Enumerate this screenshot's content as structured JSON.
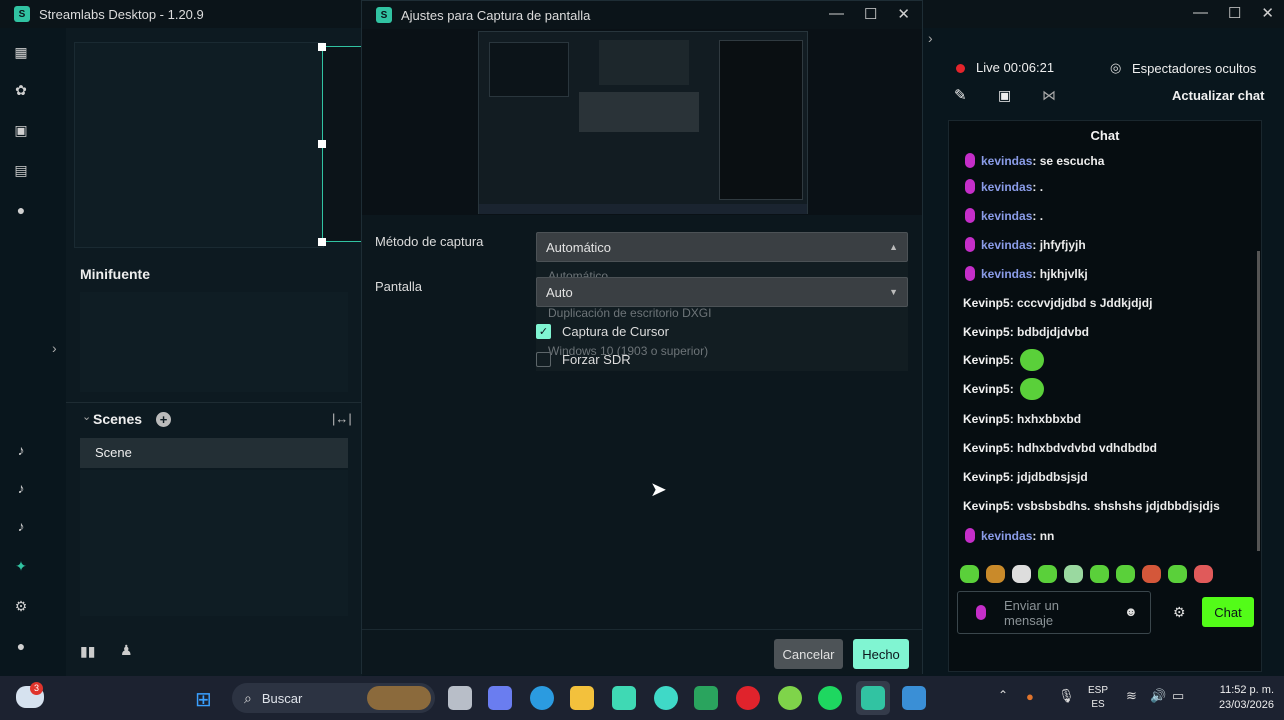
{
  "app": {
    "title": "Streamlabs Desktop - 1.20.9",
    "minifuente_label": "Minifuente",
    "scenes_label": "Scenes",
    "scenes": [
      "Scene"
    ]
  },
  "dialog": {
    "title": "Ajustes para Captura de pantalla",
    "capture_method_label": "Método de captura",
    "capture_method_value": "Automático",
    "screen_label": "Pantalla",
    "screen_value": "Auto",
    "ghost_options": [
      "Automático",
      "Duplicación de escritorio DXGI",
      "Windows 10 (1903 o superior)"
    ],
    "cursor_capture_label": "Captura de Cursor",
    "cursor_capture_checked": true,
    "force_sdr_label": "Forzar SDR",
    "force_sdr_checked": false,
    "cancel_label": "Cancelar",
    "done_label": "Hecho"
  },
  "stream": {
    "live_label": "Live",
    "live_time": "00:06:21",
    "viewers_label": "Espectadores ocultos",
    "refresh_chat_label": "Actualizar chat",
    "chat_title": "Chat",
    "messages": [
      {
        "user": "kevindas",
        "text": "se escucha",
        "mic": true
      },
      {
        "user": "kevindas",
        "text": ".",
        "mic": true
      },
      {
        "user": "kevindas",
        "text": ".",
        "mic": true
      },
      {
        "user": "kevindas",
        "text": "jhfyfjyjh",
        "mic": true
      },
      {
        "user": "kevindas",
        "text": "hjkhjvlkj",
        "mic": true
      },
      {
        "user": "Kevinp5",
        "text": "cccvvjdjdbd s Jddkjdjdj",
        "mic": false
      },
      {
        "user": "Kevinp5",
        "text": "bdbdjdjdvbd",
        "mic": false
      },
      {
        "user": "Kevinp5",
        "text": "",
        "mic": false,
        "emote": true
      },
      {
        "user": "Kevinp5",
        "text": "",
        "mic": false,
        "emote": true
      },
      {
        "user": "Kevinp5",
        "text": "hxhxbbxbd",
        "mic": false
      },
      {
        "user": "Kevinp5",
        "text": "hdhxbdvdvbd vdhdbdbd",
        "mic": false
      },
      {
        "user": "Kevinp5",
        "text": "jdjdbdbsjsjd",
        "mic": false
      },
      {
        "user": "Kevinp5",
        "text": "vsbsbsbdhs. shshshs jdjdbbdjsjdjs",
        "mic": false
      },
      {
        "user": "kevindas",
        "text": "nn",
        "mic": true
      }
    ],
    "message_placeholder": "Enviar un mensaje",
    "chat_button": "Chat"
  },
  "taskbar": {
    "search_label": "Buscar",
    "language_top": "ESP",
    "language_bottom": "ES",
    "time": "11:52 p. m.",
    "date": "23/03/2026",
    "weather_badge": "3"
  },
  "colors": {
    "accent_green": "#80f5d2",
    "live_red": "#e5242b",
    "mic_purple": "#c52ec9",
    "chat_name_blue": "#8a9ce8"
  }
}
